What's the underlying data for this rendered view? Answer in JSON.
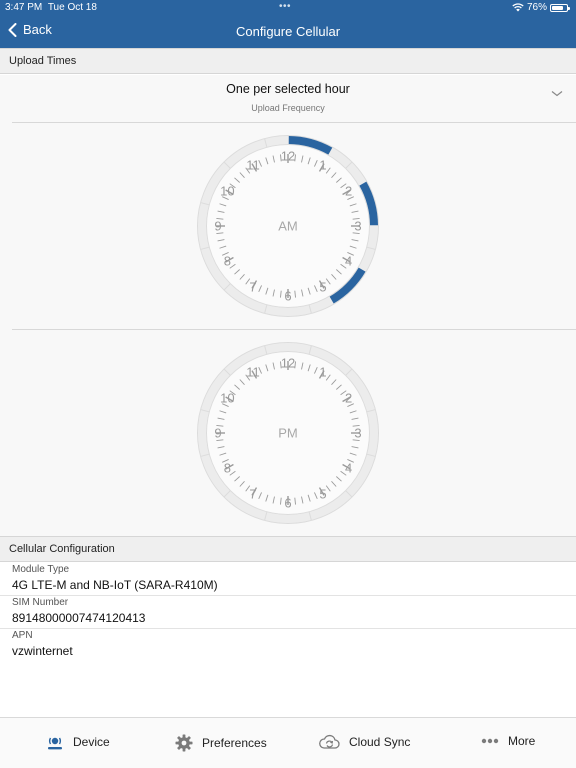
{
  "status_bar": {
    "time": "3:47 PM",
    "date": "Tue Oct 18",
    "battery": "76%",
    "battery_level": 0.76
  },
  "header": {
    "back_label": "Back",
    "title": "Configure Cellular"
  },
  "upload_times": {
    "section_title": "Upload Times",
    "frequency_value": "One per selected hour",
    "frequency_label": "Upload Frequency",
    "am_label": "AM",
    "pm_label": "PM",
    "am_selected_hours": [
      0,
      2,
      4
    ],
    "pm_selected_hours": [],
    "accent_color": "#2a64a0"
  },
  "cellular": {
    "section_title": "Cellular Configuration",
    "fields": [
      {
        "label": "Module Type",
        "value": "4G LTE-M and NB-IoT (SARA-R410M)"
      },
      {
        "label": "SIM Number",
        "value": "89148000007474120413"
      },
      {
        "label": "APN",
        "value": "vzwinternet"
      }
    ]
  },
  "tabs": [
    {
      "label": "Device",
      "icon": "device-icon",
      "active": true
    },
    {
      "label": "Preferences",
      "icon": "gear-icon",
      "active": false
    },
    {
      "label": "Cloud Sync",
      "icon": "cloud-sync-icon",
      "active": false
    },
    {
      "label": "More",
      "icon": "more-icon",
      "active": false
    }
  ]
}
